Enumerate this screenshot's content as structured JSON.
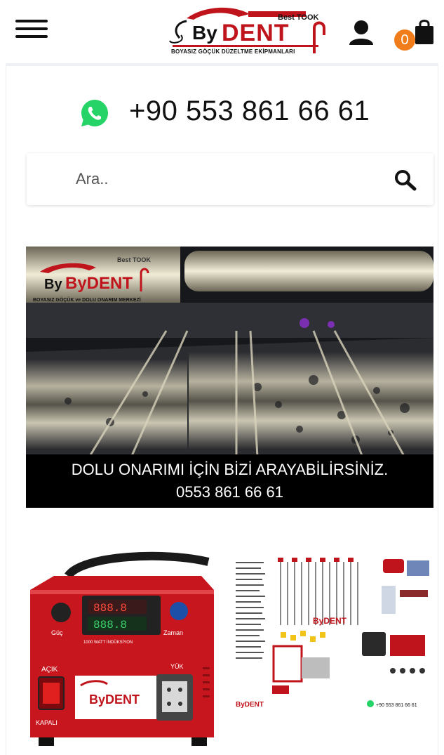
{
  "header": {
    "menu_icon": "hamburger-menu-icon",
    "logo": {
      "brand_text": "ByDENT",
      "brand_top": "Best TOOK",
      "tagline": "BOYASIZ GÖÇÜK DÜZELTME EKİPMANLARI"
    },
    "user_icon": "user-icon",
    "cart": {
      "icon": "shopping-bag-icon",
      "count": "0"
    }
  },
  "contact": {
    "whatsapp_icon": "whatsapp-icon",
    "phone": "+90 553 861 66 61"
  },
  "search": {
    "placeholder": "Ara..",
    "value": "",
    "icon": "search-icon"
  },
  "banner": {
    "logo_text": "ByDENT",
    "logo_top": "Best TOOK",
    "logo_sub": "BOYASIZ GÖÇÜK ve DOLU ONARIM MERKEZİ",
    "caption_line1": "DOLU ONARIMI İÇİN BİZİ ARAYABİLİRSİNİZ.",
    "caption_line2": "0553 861 66 61"
  },
  "products": [
    {
      "name": "induction-heater",
      "labels": {
        "left_knob": "Güç",
        "right_knob": "Zaman",
        "center": "1000 WATT İNDÜKSİYON",
        "switch_on": "AÇIK",
        "switch_off": "KAPALI",
        "socket": "YÜK",
        "brand": "ByDENT"
      }
    },
    {
      "name": "pdr-tool-set",
      "labels": {
        "brand": "ByDENT",
        "phone": "+90 553 861 66 61"
      }
    }
  ],
  "colors": {
    "accent_orange": "#f07d1a",
    "brand_red": "#c0141c",
    "whatsapp_green": "#25d366",
    "banner_caption_bg": "#000000"
  }
}
